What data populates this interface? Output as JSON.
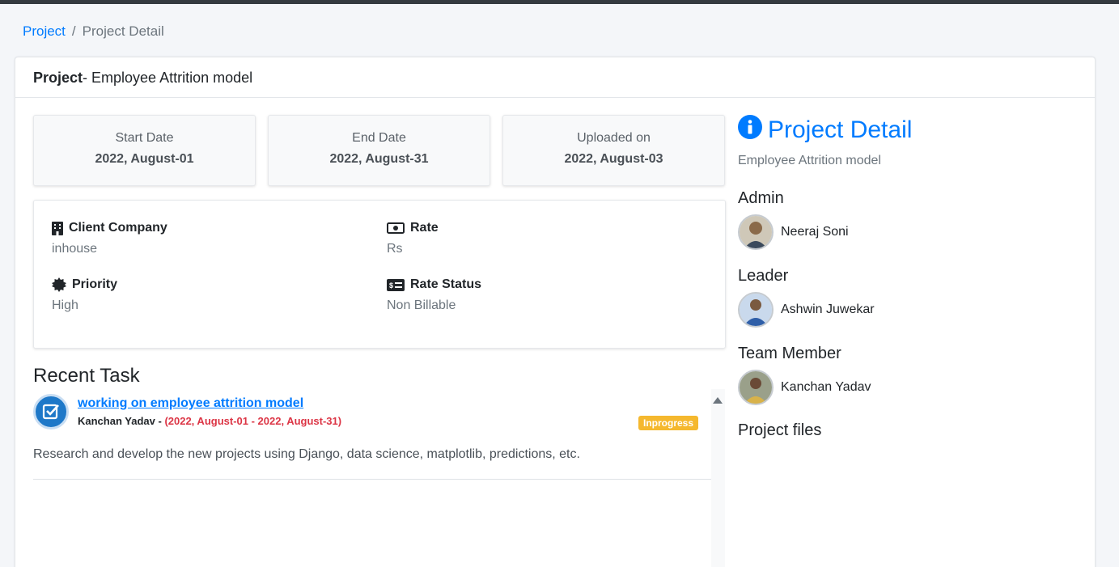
{
  "breadcrumb": {
    "root": "Project",
    "separator": "/",
    "current": "Project Detail"
  },
  "header": {
    "label_bold": "Project",
    "title_suffix": "- Employee Attrition model"
  },
  "dates": [
    {
      "label": "Start Date",
      "value": "2022, August-01"
    },
    {
      "label": "End Date",
      "value": "2022, August-31"
    },
    {
      "label": "Uploaded on",
      "value": "2022, August-03"
    }
  ],
  "info": {
    "client_company": {
      "label": "Client Company",
      "value": "inhouse",
      "icon": "building-icon"
    },
    "rate": {
      "label": "Rate",
      "value": "Rs",
      "icon": "money-icon"
    },
    "priority": {
      "label": "Priority",
      "value": "High",
      "icon": "certificate-icon"
    },
    "rate_status": {
      "label": "Rate Status",
      "value": "Non Billable",
      "icon": "money-check-icon"
    }
  },
  "recent": {
    "title": "Recent Task",
    "task": {
      "title": "working on employee attrition model",
      "assignee": "Kanchan Yadav -",
      "dates": "(2022, August-01 - 2022, August-31)",
      "status": "Inprogress",
      "description": "Research and develop the new projects using Django, data science, matplotlib, predictions, etc."
    }
  },
  "side": {
    "title": "Project Detail",
    "description": "Employee Attrition model",
    "admin_heading": "Admin",
    "admin_name": "Neeraj Soni",
    "leader_heading": "Leader",
    "leader_name": "Ashwin Juwekar",
    "member_heading": "Team Member",
    "member_name": "Kanchan Yadav",
    "files_heading": "Project files"
  },
  "colors": {
    "accent": "#007bff",
    "badge": "#f5b82e",
    "dates_red": "#dc3545",
    "topbar": "#343a40"
  }
}
